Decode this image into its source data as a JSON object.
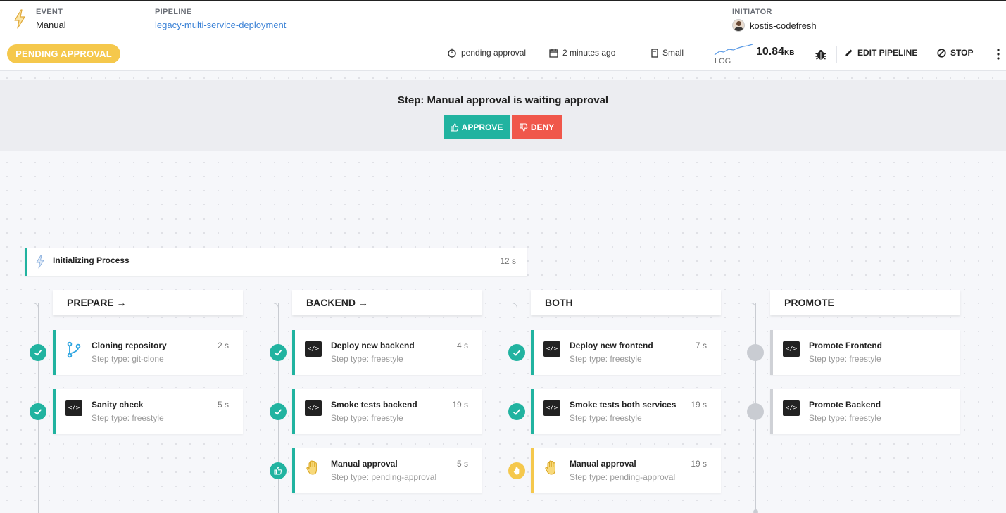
{
  "header": {
    "event_label": "EVENT",
    "event_value": "Manual",
    "pipeline_label": "PIPELINE",
    "pipeline_value": "legacy-multi-service-deployment",
    "initiator_label": "INITIATOR",
    "initiator_value": "kostis-codefresh"
  },
  "toolbar": {
    "status_badge": "PENDING APPROVAL",
    "status_text": "pending approval",
    "time_ago": "2 minutes ago",
    "size": "Small",
    "log_label": "LOG",
    "log_size_value": "10.84",
    "log_size_unit": "KB",
    "edit_label": "EDIT PIPELINE",
    "stop_label": "STOP"
  },
  "banner": {
    "title": "Step: Manual approval is waiting approval",
    "approve_label": "APPROVE",
    "deny_label": "DENY"
  },
  "init": {
    "title": "Initializing Process",
    "time": "12 s"
  },
  "stages": [
    {
      "name": "PREPARE →",
      "steps": [
        {
          "title": "Cloning repository",
          "type": "Step type: git-clone",
          "time": "2 s",
          "status": "ok",
          "icon": "git-branch-icon"
        },
        {
          "title": "Sanity check",
          "type": "Step type: freestyle",
          "time": "5 s",
          "status": "ok",
          "icon": "code-icon"
        }
      ]
    },
    {
      "name": "BACKEND →",
      "steps": [
        {
          "title": "Deploy new backend",
          "type": "Step type: freestyle",
          "time": "4 s",
          "status": "ok",
          "icon": "code-icon"
        },
        {
          "title": "Smoke tests backend",
          "type": "Step type: freestyle",
          "time": "19 s",
          "status": "ok",
          "icon": "code-icon"
        },
        {
          "title": "Manual approval",
          "type": "Step type: pending-approval",
          "time": "5 s",
          "status": "approved",
          "icon": "hand-icon"
        }
      ]
    },
    {
      "name": "BOTH",
      "steps": [
        {
          "title": "Deploy new frontend",
          "type": "Step type: freestyle",
          "time": "7 s",
          "status": "ok",
          "icon": "code-icon"
        },
        {
          "title": "Smoke tests both services",
          "type": "Step type: freestyle",
          "time": "19 s",
          "status": "ok",
          "icon": "code-icon"
        },
        {
          "title": "Manual approval",
          "type": "Step type: pending-approval",
          "time": "19 s",
          "status": "wait",
          "icon": "hand-icon"
        }
      ]
    },
    {
      "name": "PROMOTE",
      "steps": [
        {
          "title": "Promote Frontend",
          "type": "Step type: freestyle",
          "time": "",
          "status": "idle",
          "icon": "code-icon"
        },
        {
          "title": "Promote Backend",
          "type": "Step type: freestyle",
          "time": "",
          "status": "idle",
          "icon": "code-icon"
        }
      ]
    }
  ],
  "colors": {
    "accent": "#21b3a0",
    "pending": "#f5c84c",
    "deny": "#f0574b",
    "link": "#3b82d6",
    "idle": "#c9ccd2"
  }
}
